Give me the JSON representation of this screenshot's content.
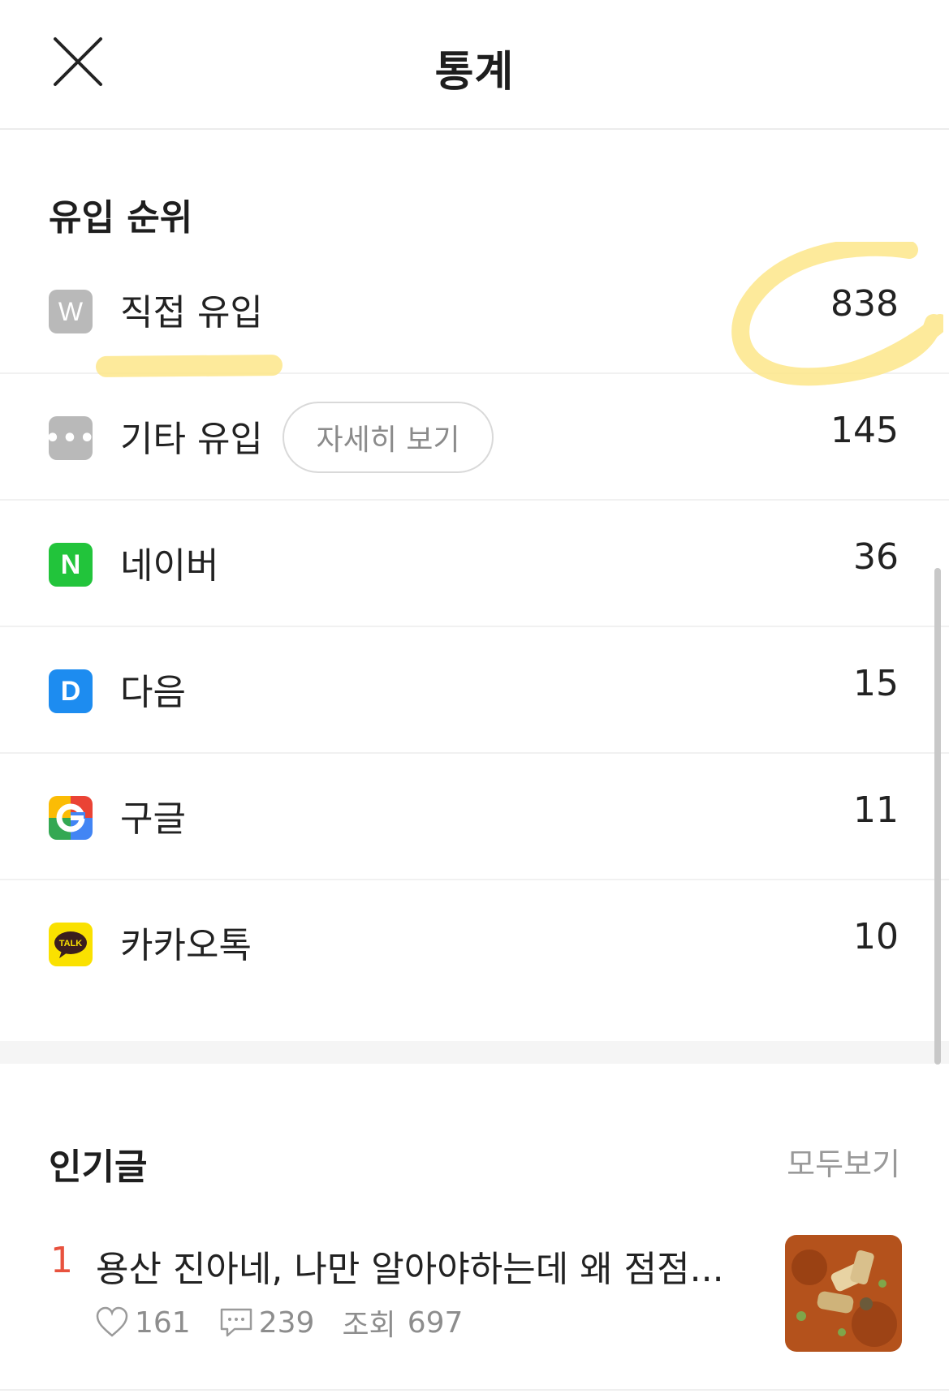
{
  "header": {
    "title": "통계",
    "close_icon": "close-icon"
  },
  "inflow": {
    "section_title": "유입 순위",
    "detail_button_label": "자세히 보기",
    "items": [
      {
        "label": "직접 유입",
        "count": "838",
        "icon": "direct-w-icon",
        "icon_text": "W",
        "icon_color": "#b9b9b9"
      },
      {
        "label": "기타 유입",
        "count": "145",
        "icon": "more-icon",
        "icon_text": "•••",
        "icon_color": "#b9b9b9"
      },
      {
        "label": "네이버",
        "count": "36",
        "icon": "naver-icon",
        "icon_text": "N",
        "icon_color": "#22c43b"
      },
      {
        "label": "다음",
        "count": "15",
        "icon": "daum-icon",
        "icon_text": "D",
        "icon_color": "#1d8cf0"
      },
      {
        "label": "구글",
        "count": "11",
        "icon": "google-icon",
        "icon_text": "G",
        "icon_color": "#4285f4"
      },
      {
        "label": "카카오톡",
        "count": "10",
        "icon": "kakaotalk-icon",
        "icon_text": "TALK",
        "icon_color": "#fae100"
      }
    ]
  },
  "popular": {
    "section_title": "인기글",
    "see_all_label": "모두보기",
    "posts": [
      {
        "rank": "1",
        "title": "용산 진아네, 나만 알아야하는데 왜 점점...",
        "likes": "161",
        "comments": "239",
        "views_label": "조회",
        "views": "697"
      }
    ]
  },
  "colors": {
    "highlight": "#fde68a",
    "rank_accent": "#e8523e"
  }
}
